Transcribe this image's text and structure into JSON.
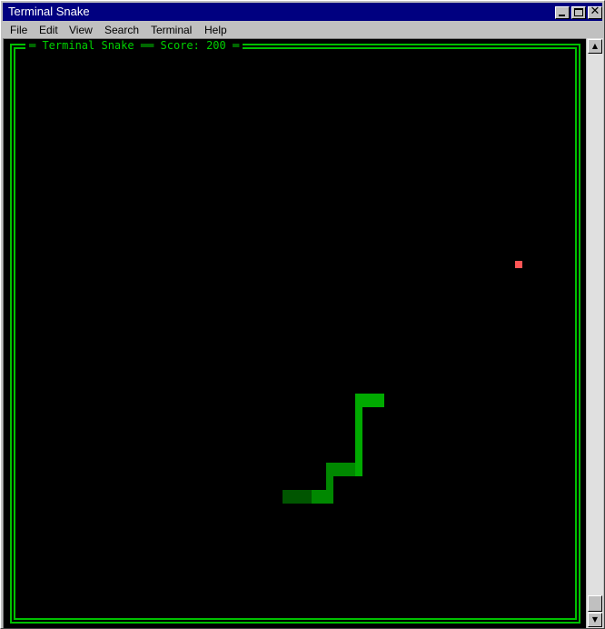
{
  "window": {
    "title": "Terminal Snake",
    "buttons": {
      "minimize_icon": "minimize-icon",
      "maximize_icon": "maximize-icon",
      "close_icon": "close-icon",
      "close_glyph": "✕"
    }
  },
  "menu": {
    "items": [
      "File",
      "Edit",
      "View",
      "Search",
      "Terminal",
      "Help"
    ]
  },
  "game": {
    "frame_title": "═ Terminal Snake ══ Score: 200 ═",
    "score": 200,
    "colors": {
      "background": "#000000",
      "frame": "#00c000",
      "snake_head": "#00aa00",
      "snake_body": "#008800",
      "snake_tail": "#005500",
      "food": "#ff5555"
    }
  },
  "scrollbar": {
    "up_glyph": "▲",
    "down_glyph": "▼"
  }
}
